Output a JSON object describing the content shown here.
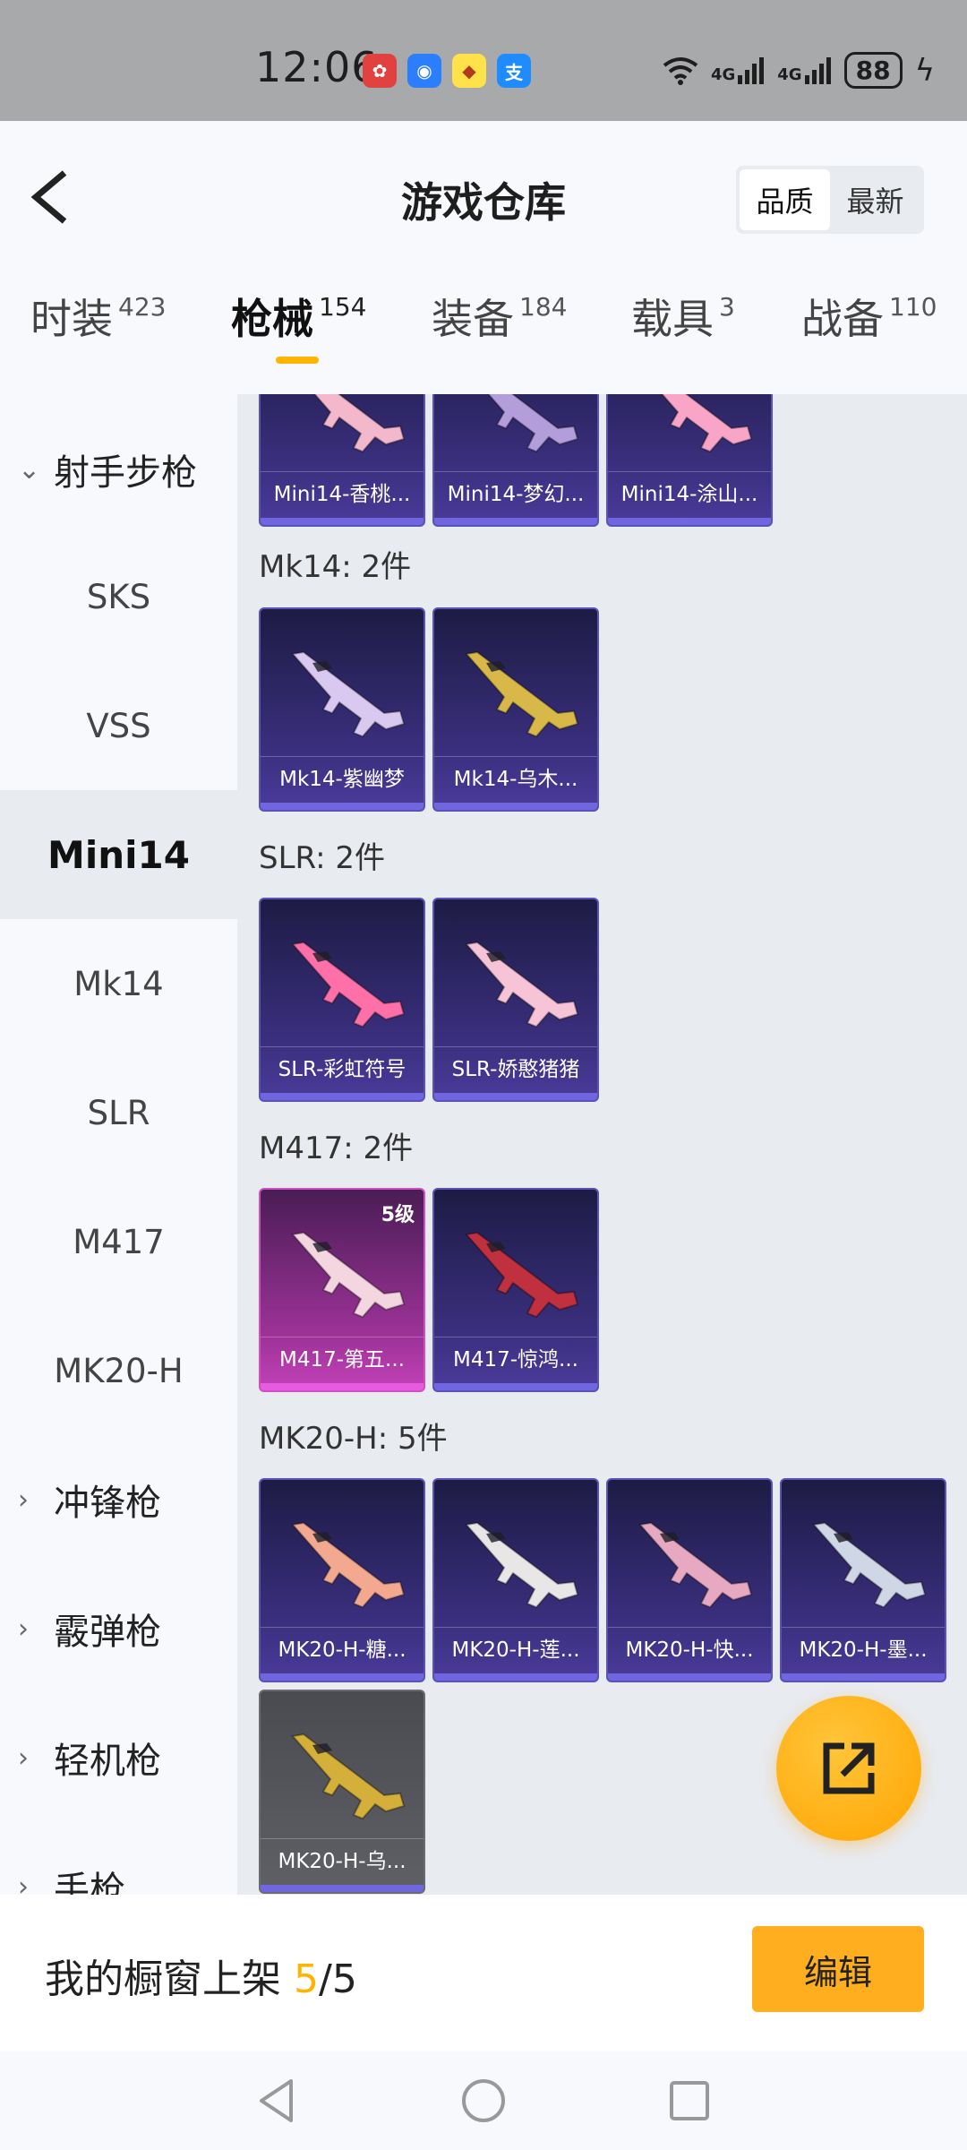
{
  "status_bar": {
    "time": "12:06",
    "signal1": "4G",
    "signal2": "4G",
    "battery": "88"
  },
  "header": {
    "title": "游戏仓库",
    "sort_options": [
      "品质",
      "最新"
    ],
    "sort_selected": "品质"
  },
  "tabs": [
    {
      "label": "时装",
      "count": "423"
    },
    {
      "label": "枪械",
      "count": "154"
    },
    {
      "label": "装备",
      "count": "184"
    },
    {
      "label": "载具",
      "count": "3"
    },
    {
      "label": "战备",
      "count": "110"
    }
  ],
  "active_tab": "枪械",
  "sidebar": {
    "categories": [
      {
        "label": "射手步枪",
        "expanded": true
      },
      {
        "label": "冲锋枪",
        "expanded": false
      },
      {
        "label": "霰弹枪",
        "expanded": false
      },
      {
        "label": "轻机枪",
        "expanded": false
      },
      {
        "label": "手枪",
        "expanded": false
      }
    ],
    "subitems": [
      "SKS",
      "VSS",
      "Mini14",
      "Mk14",
      "SLR",
      "M417",
      "MK20-H"
    ],
    "active_subitem": "Mini14"
  },
  "groups": [
    {
      "title": "",
      "items": [
        {
          "name": "Mini14-香桃...",
          "color": "#f4b8cc"
        },
        {
          "name": "Mini14-梦幻...",
          "color": "#b39ddb"
        },
        {
          "name": "Mini14-涂山...",
          "color": "#f8a5c8"
        }
      ]
    },
    {
      "title": "Mk14: 2件",
      "items": [
        {
          "name": "Mk14-紫幽梦",
          "color": "#d9c9f0"
        },
        {
          "name": "Mk14-乌木...",
          "color": "#d9b84a"
        }
      ]
    },
    {
      "title": "SLR: 2件",
      "items": [
        {
          "name": "SLR-彩虹符号",
          "color": "#ff6fa8"
        },
        {
          "name": "SLR-娇憨猪猪",
          "color": "#f6c4d6"
        }
      ]
    },
    {
      "title": "M417: 2件",
      "items": [
        {
          "name": "M417-第五...",
          "color": "#f3d6e0",
          "level": "5级"
        },
        {
          "name": "M417-惊鸿...",
          "color": "#c0303e"
        }
      ]
    },
    {
      "title": "MK20-H: 5件",
      "items": [
        {
          "name": "MK20-H-糖...",
          "color": "#f2a98f"
        },
        {
          "name": "MK20-H-莲...",
          "color": "#e8e6e6"
        },
        {
          "name": "MK20-H-快...",
          "color": "#e7a9c2"
        },
        {
          "name": "MK20-H-墨...",
          "color": "#cfd6e6"
        },
        {
          "name": "MK20-H-乌...",
          "color": "#d4b03a"
        }
      ]
    }
  ],
  "bottom_bar": {
    "text": "我的橱窗上架",
    "count": "5",
    "total": "/5",
    "edit_label": "编辑"
  },
  "colors": {
    "accent": "#ffb400",
    "card_purple": "#3a2f7e",
    "card_pink": "#c342b8",
    "card_grey": "#5f6066"
  }
}
